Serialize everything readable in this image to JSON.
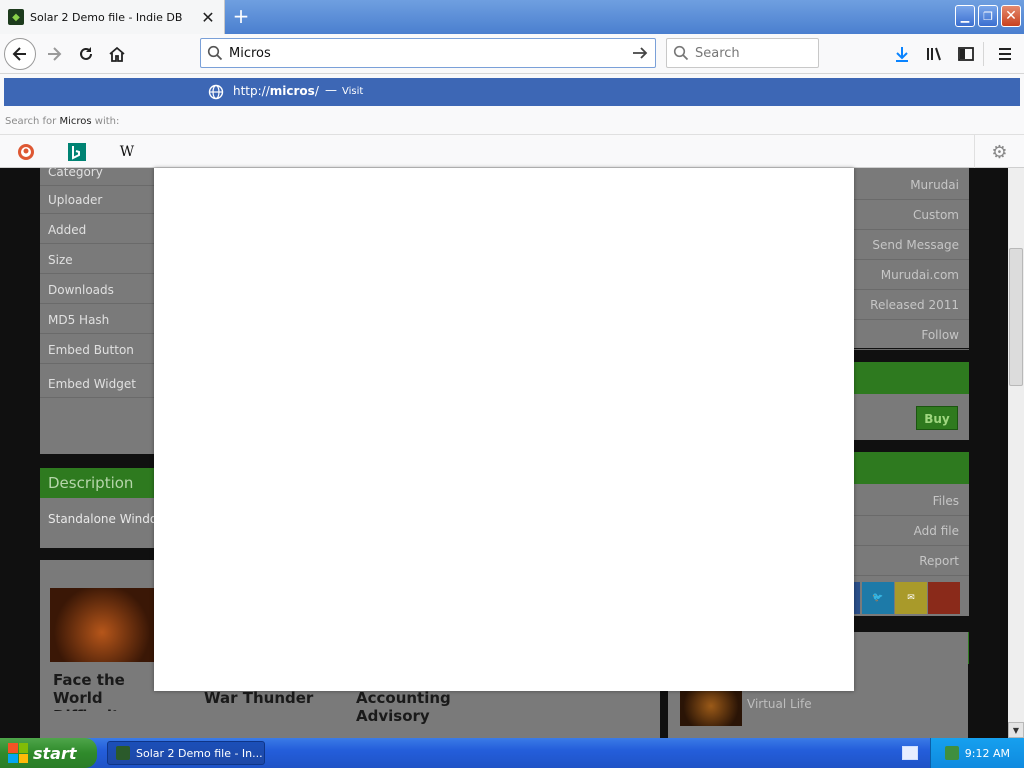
{
  "browser": {
    "tab_title": "Solar 2 Demo file - Indie DB",
    "url_value": "Micros",
    "search_placeholder": "Search"
  },
  "autocomplete": {
    "suggestion_prefix": "http://",
    "suggestion_host": "micros",
    "suggestion_suffix": "/",
    "dash": "—",
    "visit": "Visit",
    "search_for": "Search for ",
    "search_term": "Micros",
    "search_with": " with:",
    "engines": [
      "duckduckgo-icon",
      "bing-icon",
      "wikipedia-icon"
    ],
    "wiki_glyph": "W"
  },
  "page": {
    "left_rows": [
      "Category",
      "Uploader",
      "Added",
      "Size",
      "Downloads",
      "MD5 Hash",
      "Embed Button",
      "Embed Widget"
    ],
    "description_title": "Description",
    "description_text": "Standalone Windows",
    "cards": [
      "Face the World Difficulty",
      "War Thunder",
      "Accounting Advisory"
    ],
    "right_rows": [
      "Murudai",
      "Custom",
      "Send Message",
      "Murudai.com",
      "Released 2011",
      "Follow"
    ],
    "buy_label": "Buy",
    "right_links": [
      "Files",
      "Add file",
      "Report"
    ],
    "virtual_life": "Virtual Life"
  },
  "taskbar": {
    "start_label": "start",
    "task_title": "Solar 2 Demo file - In...",
    "clock": "9:12 AM"
  },
  "colors": {
    "accent_blue": "#3d67b5",
    "indie_green": "#2e7a1f",
    "xp_taskbar": "#245edb"
  }
}
